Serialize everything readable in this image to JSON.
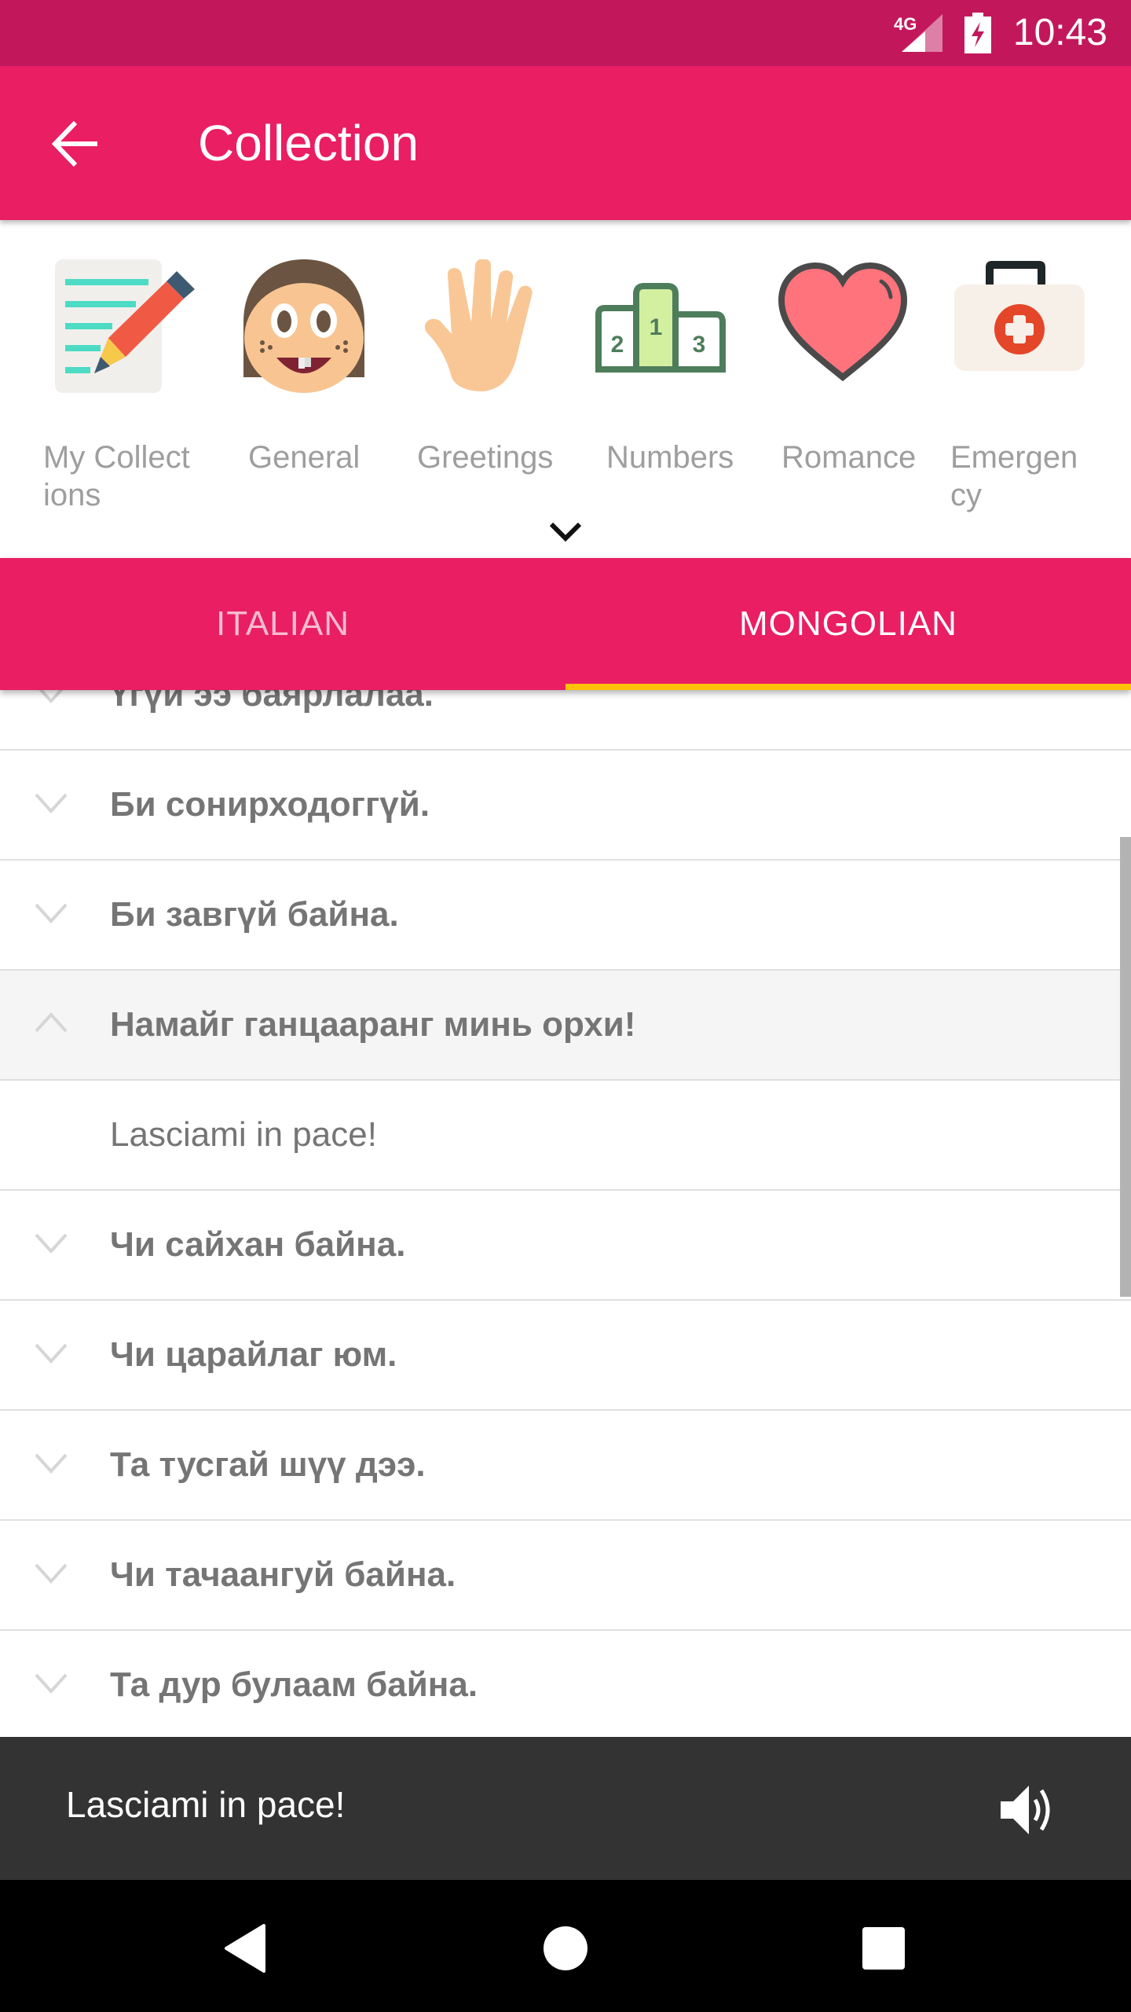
{
  "status_bar": {
    "network": "4G",
    "time": "10:43"
  },
  "app_bar": {
    "title": "Collection",
    "back_icon": "arrow-left-icon"
  },
  "categories": [
    {
      "label": "My Collect\nions",
      "icon": "notepad-pencil-icon"
    },
    {
      "label": "General",
      "icon": "girl-face-icon"
    },
    {
      "label": "Greetings",
      "icon": "waving-hand-icon"
    },
    {
      "label": "Numbers",
      "icon": "podium-icon"
    },
    {
      "label": "Romance",
      "icon": "heart-icon"
    },
    {
      "label": "Emergen\ncy",
      "icon": "first-aid-kit-icon"
    }
  ],
  "tabs": [
    {
      "label": "ITALIAN",
      "active": false
    },
    {
      "label": "MONGOLIAN",
      "active": true
    }
  ],
  "phrases": [
    {
      "text": "Үгүй ээ баярлалаа.",
      "expanded": false
    },
    {
      "text": "Би сонирходоггүй.",
      "expanded": false
    },
    {
      "text": "Би завгүй байна.",
      "expanded": false
    },
    {
      "text": "Намайг ганцааранг минь орхи!",
      "expanded": true,
      "translation": "Lasciami in pace!"
    },
    {
      "text": "Чи сайхан байна.",
      "expanded": false
    },
    {
      "text": "Чи царайлаг юм.",
      "expanded": false
    },
    {
      "text": "Та тусгай шүү дээ.",
      "expanded": false
    },
    {
      "text": "Чи тачаангуй байна.",
      "expanded": false
    },
    {
      "text": "Та дур булаам байна.",
      "expanded": false
    }
  ],
  "player": {
    "text": "Lasciami in pace!",
    "icon": "speaker-icon"
  },
  "colors": {
    "primary": "#E91E63",
    "primary_dark": "#C2185B",
    "tab_indicator": "#FFC107",
    "player_bg": "#333333"
  }
}
